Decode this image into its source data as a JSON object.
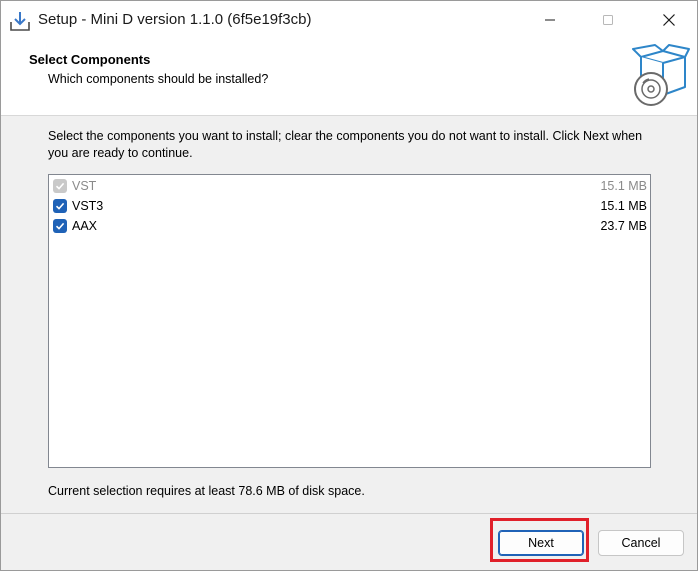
{
  "window": {
    "title": "Setup - Mini D version 1.1.0 (6f5e19f3cb)"
  },
  "header": {
    "title": "Select Components",
    "subtitle": "Which components should be installed?"
  },
  "body": {
    "instructions": "Select the components you want to install; clear the components you do not want to install. Click Next when you are ready to continue.",
    "components": [
      {
        "name": "VST",
        "size": "15.1 MB",
        "checked": true,
        "enabled": false
      },
      {
        "name": "VST3",
        "size": "15.1 MB",
        "checked": true,
        "enabled": true
      },
      {
        "name": "AAX",
        "size": "23.7 MB",
        "checked": true,
        "enabled": true
      }
    ],
    "disk_space": "Current selection requires at least 78.6 MB of disk space."
  },
  "footer": {
    "next_label": "Next",
    "cancel_label": "Cancel"
  },
  "colors": {
    "accent": "#1f62b7",
    "highlight": "#e0202a"
  }
}
